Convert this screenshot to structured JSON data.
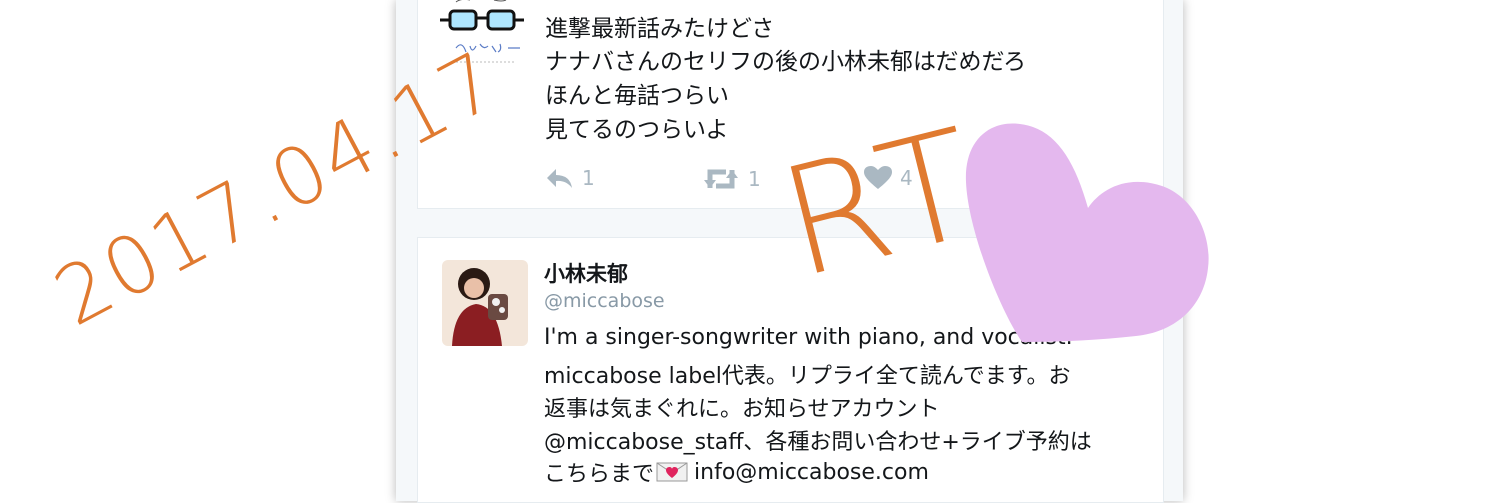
{
  "tweet": {
    "name": "",
    "lines": [
      "進撃最新話みたけどさ",
      "ナナバさんのセリフの後の小林未郁はだめだろ",
      "ほんと毎話つらい",
      "見てるのつらいよ"
    ],
    "reply_count": "1",
    "retweet_count": "1",
    "like_count": "4"
  },
  "overlay": {
    "date": "2017.04.17",
    "rt": "RT",
    "heart_color": "#e4b8ee",
    "text_color": "#e07a30"
  },
  "profile": {
    "name": "小林未郁",
    "handle": "@miccabose",
    "bio_lines": [
      "I'm a singer-songwriter with piano, and vocalist.",
      "miccabose label代表。リプライ全て読んでます。お",
      "返事は気まぐれに。お知らせアカウント",
      "@miccabose_staff、各種お問い合わせ+ライブ予約は",
      "こちらまで",
      "info@miccabose.com"
    ]
  }
}
